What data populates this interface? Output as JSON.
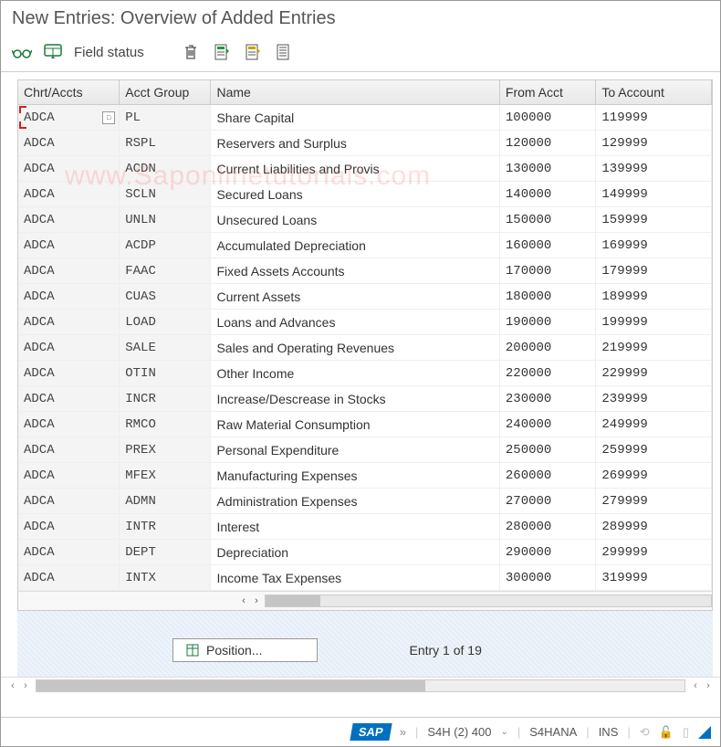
{
  "title": "New Entries: Overview of Added Entries",
  "toolbar": {
    "field_status_label": "Field status"
  },
  "watermark": "www.Saponlinetutorials.com",
  "columns": {
    "chrt": "Chrt/Accts",
    "grp": "Acct Group",
    "name": "Name",
    "from": "From Acct",
    "to": "To Account"
  },
  "rows": [
    {
      "chrt": "ADCA",
      "grp": "PL",
      "name": "Share Capital",
      "from": "100000",
      "to": "119999"
    },
    {
      "chrt": "ADCA",
      "grp": "RSPL",
      "name": "Reservers and Surplus",
      "from": "120000",
      "to": "129999"
    },
    {
      "chrt": "ADCA",
      "grp": "ACDN",
      "name": "Current Liabilities and Provis",
      "from": "130000",
      "to": "139999"
    },
    {
      "chrt": "ADCA",
      "grp": "SCLN",
      "name": "Secured Loans",
      "from": "140000",
      "to": "149999"
    },
    {
      "chrt": "ADCA",
      "grp": "UNLN",
      "name": "Unsecured Loans",
      "from": "150000",
      "to": "159999"
    },
    {
      "chrt": "ADCA",
      "grp": "ACDP",
      "name": "Accumulated Depreciation",
      "from": "160000",
      "to": "169999"
    },
    {
      "chrt": "ADCA",
      "grp": "FAAC",
      "name": "Fixed Assets Accounts",
      "from": "170000",
      "to": "179999"
    },
    {
      "chrt": "ADCA",
      "grp": "CUAS",
      "name": "Current Assets",
      "from": "180000",
      "to": "189999"
    },
    {
      "chrt": "ADCA",
      "grp": "LOAD",
      "name": "Loans and Advances",
      "from": "190000",
      "to": "199999"
    },
    {
      "chrt": "ADCA",
      "grp": "SALE",
      "name": "Sales and Operating Revenues",
      "from": "200000",
      "to": "219999"
    },
    {
      "chrt": "ADCA",
      "grp": "OTIN",
      "name": "Other Income",
      "from": "220000",
      "to": "229999"
    },
    {
      "chrt": "ADCA",
      "grp": "INCR",
      "name": "Increase/Descrease in Stocks",
      "from": "230000",
      "to": "239999"
    },
    {
      "chrt": "ADCA",
      "grp": "RMCO",
      "name": "Raw Material Consumption",
      "from": "240000",
      "to": "249999"
    },
    {
      "chrt": "ADCA",
      "grp": "PREX",
      "name": "Personal Expenditure",
      "from": "250000",
      "to": "259999"
    },
    {
      "chrt": "ADCA",
      "grp": "MFEX",
      "name": "Manufacturing Expenses",
      "from": "260000",
      "to": "269999"
    },
    {
      "chrt": "ADCA",
      "grp": "ADMN",
      "name": "Administration Expenses",
      "from": "270000",
      "to": "279999"
    },
    {
      "chrt": "ADCA",
      "grp": "INTR",
      "name": "Interest",
      "from": "280000",
      "to": "289999"
    },
    {
      "chrt": "ADCA",
      "grp": "DEPT",
      "name": "Depreciation",
      "from": "290000",
      "to": "299999"
    },
    {
      "chrt": "ADCA",
      "grp": "INTX",
      "name": "Income Tax Expenses",
      "from": "300000",
      "to": "319999"
    }
  ],
  "position_button": "Position...",
  "entry_count": "Entry 1 of 19",
  "status": {
    "system": "S4H (2) 400",
    "server": "S4HANA",
    "mode": "INS"
  }
}
